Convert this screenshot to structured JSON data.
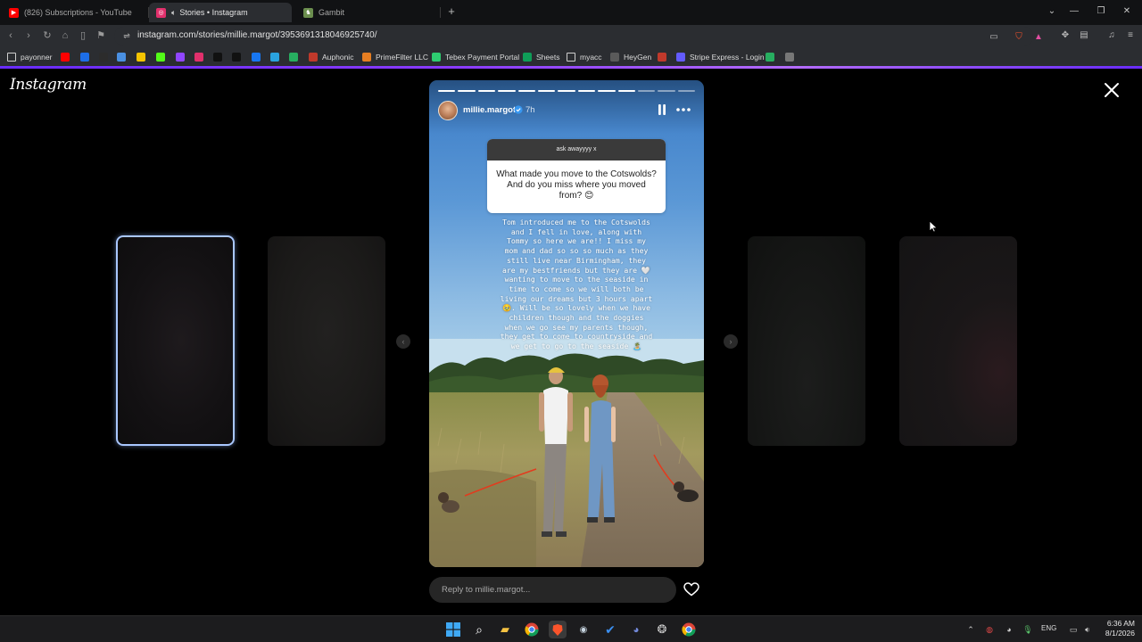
{
  "browser": {
    "tabs": [
      {
        "label": "(826) Subscriptions - YouTube",
        "icon": "youtube-icon",
        "color": "#ff0000",
        "active": false
      },
      {
        "label": "Stories • Instagram",
        "icon": "instagram-icon",
        "color": "#e1306c",
        "active": true
      },
      {
        "label": "Gambit",
        "icon": "gambit-icon",
        "color": "#6b8e4e",
        "active": false
      }
    ],
    "url": "instagram.com/stories/millie.margot/3953691318046925740/",
    "bookmarks": [
      {
        "label": "payonner",
        "icon": "folder-icon"
      },
      {
        "label": "",
        "icon": "youtube-icon",
        "color": "#ff0000"
      },
      {
        "label": "",
        "icon": "plus-icon",
        "color": "#1d6ee8"
      },
      {
        "label": "",
        "icon": "app-icon",
        "color": "#2c2c2c"
      },
      {
        "label": "",
        "icon": "star-icon",
        "color": "#4a90e2"
      },
      {
        "label": "",
        "icon": "bookmark-yellow-icon",
        "color": "#f5c400"
      },
      {
        "label": "",
        "icon": "kick-icon",
        "color": "#53fc18"
      },
      {
        "label": "",
        "icon": "twitch-icon",
        "color": "#9146ff"
      },
      {
        "label": "",
        "icon": "instagram-icon",
        "color": "#e1306c"
      },
      {
        "label": "",
        "icon": "tiktok-icon",
        "color": "#111111"
      },
      {
        "label": "",
        "icon": "x-icon",
        "color": "#111111"
      },
      {
        "label": "",
        "icon": "facebook-icon",
        "color": "#1877f2"
      },
      {
        "label": "",
        "icon": "telegram-icon",
        "color": "#2aa3df"
      },
      {
        "label": "",
        "icon": "green-app-icon",
        "color": "#27ae60"
      },
      {
        "label": "Auphonic",
        "icon": "auphonic-icon",
        "color": "#c0392b"
      },
      {
        "label": "PrimeFilter LLC",
        "icon": "primefilter-icon",
        "color": "#e67e22"
      },
      {
        "label": "Tebex Payment Portal",
        "icon": "tebex-icon",
        "color": "#2ecc71"
      },
      {
        "label": "Sheets",
        "icon": "sheets-icon",
        "color": "#0f9d58"
      },
      {
        "label": "myacc",
        "icon": "folder-icon"
      },
      {
        "label": "HeyGen",
        "icon": "heygen-icon",
        "color": "#5a5a5a"
      },
      {
        "label": "",
        "icon": "red-app-icon",
        "color": "#c0392b"
      },
      {
        "label": "Stripe Express - Login",
        "icon": "stripe-icon",
        "color": "#635bff"
      },
      {
        "label": "",
        "icon": "green-app-icon",
        "color": "#27ae60"
      },
      {
        "label": "",
        "icon": "globe-icon",
        "color": "#777777"
      }
    ]
  },
  "instagram": {
    "logo": "Instagram",
    "story": {
      "username": "millie.margot",
      "time": "7h",
      "segments_total": 13,
      "segments_done": 10,
      "question_header": "ask awayyyy x",
      "question": "What made you move to the Cotswolds? And do you miss where you moved from? 😊",
      "answer_lines": [
        "Tom introduced me to the Cotswolds",
        "and I fell in love, along with",
        "Tommy so here we are!! I miss my",
        "mom and dad so so so much as they",
        "still live near Birmingham, they",
        "are my bestfriends but they are 🤍",
        "wanting to move to the seaside in",
        "time to come so we will both be",
        "living our dreams but 3 hours apart",
        "🥹. Will be so lovely when we have",
        "children though and the doggies",
        "when we go see my parents though,",
        "they get to come to countryside and",
        "we get to go to the seaside 🏝️"
      ],
      "reply_placeholder": "Reply to millie.margot..."
    }
  },
  "taskbar": {
    "language": "ENG",
    "time": "6:36 AM",
    "date": "8/1/2026"
  },
  "colors": {
    "accent_gradient": "#8a3bff",
    "story_sky": "#5b98d6",
    "active_card_border": "#a9c7ff"
  }
}
